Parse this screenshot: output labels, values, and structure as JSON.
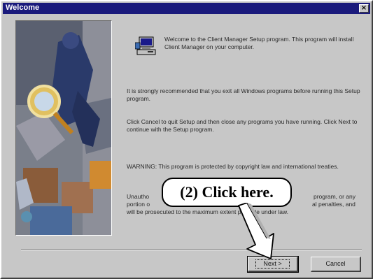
{
  "window": {
    "title": "Welcome",
    "close_glyph": "×"
  },
  "icons": {
    "art": "welcome-illustration",
    "setup": "computer-setup-icon",
    "pointer": "pointer-arrow-icon"
  },
  "content": {
    "intro": "Welcome to the Client Manager Setup program. This program will install Client Manager on your computer.",
    "recommend": "It is strongly recommended that you exit all Windows programs before running this Setup program.",
    "instructions": "Click Cancel to quit Setup and then close any programs you have running. Click Next to continue with the Setup program.",
    "warning": "WARNING: This program is protected by copyright law and international treaties.",
    "unauthorized_start": "Unautho",
    "unauthorized_mid": "program, or any",
    "unauthorized_line2_start": "portion o",
    "unauthorized_line2_end": "al penalties, and",
    "unauthorized_line3": "will be prosecuted to the maximum extent possible under law."
  },
  "buttons": {
    "next_label": "Next >",
    "cancel_label": "Cancel"
  },
  "annotation": {
    "callout_text": "(2)  Click here."
  },
  "colors": {
    "titlebar": "#1a1a7c",
    "dialog_face": "#c7c7c7"
  }
}
